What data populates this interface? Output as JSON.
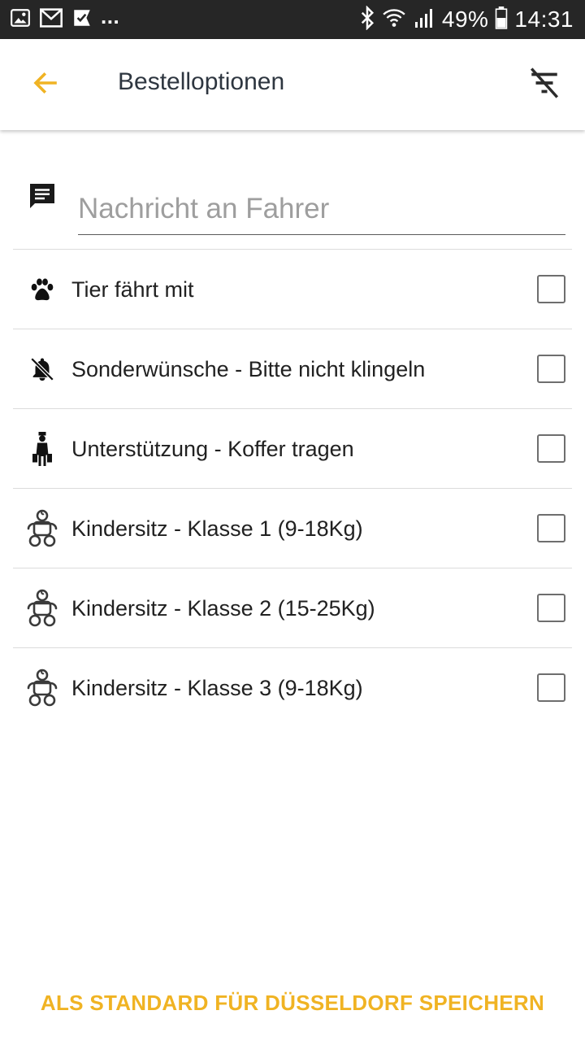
{
  "status_bar": {
    "overflow": "...",
    "battery": "49%",
    "time": "14:31",
    "icons": [
      "gallery-icon",
      "gmail-icon",
      "check-app-icon",
      "bluetooth-icon",
      "wifi-icon",
      "signal-icon",
      "battery-icon"
    ]
  },
  "app_bar": {
    "title": "Bestelloptionen",
    "back_icon": "arrow-left-icon",
    "filter_icon": "filter-off-icon"
  },
  "message": {
    "placeholder": "Nachricht an Fahrer",
    "value": "",
    "icon": "message-icon"
  },
  "options": [
    {
      "label": "Tier fährt mit",
      "icon": "paw-icon",
      "checked": false
    },
    {
      "label": "Sonderwünsche - Bitte nicht klingeln",
      "icon": "bell-off-icon",
      "checked": false
    },
    {
      "label": "Unterstützung - Koffer tragen",
      "icon": "porter-luggage-icon",
      "checked": false
    },
    {
      "label": "Kindersitz - Klasse 1 (9-18Kg)",
      "icon": "baby-icon",
      "checked": false
    },
    {
      "label": "Kindersitz - Klasse 2 (15-25Kg)",
      "icon": "baby-icon",
      "checked": false
    },
    {
      "label": "Kindersitz - Klasse 3 (9-18Kg)",
      "icon": "baby-icon",
      "checked": false
    }
  ],
  "footer": {
    "save_label": "ALS STANDARD FÜR DÜSSELDORF SPEICHERN"
  },
  "colors": {
    "accent": "#f0b323",
    "status_bar": "#262626",
    "title": "#2e3640",
    "divider": "#dcdcdc"
  }
}
